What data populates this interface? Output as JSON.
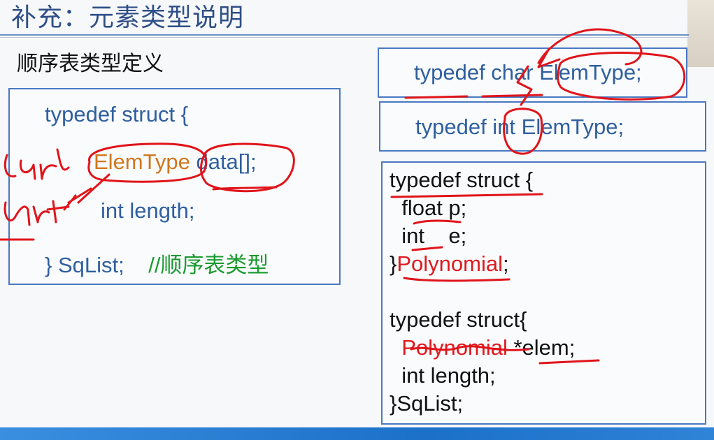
{
  "slide": {
    "title": "补充：元素类型说明",
    "subtitle": "顺序表类型定义"
  },
  "left_box": {
    "line1": "typedef struct {",
    "line2_type": "ElemType",
    "line2_rest": " data[];",
    "line3": "int length;",
    "line4_code": "} SqList;",
    "line4_comment": "//顺序表类型"
  },
  "right_top": {
    "box1": "typedef char ElemType;",
    "box2": "typedef int ElemType;"
  },
  "right_code": {
    "l1": "typedef struct {",
    "l2": "  float p;",
    "l3": "  int    e;",
    "l4_brace": "}",
    "l4_name": "Polynomial",
    "l4_end": ";",
    "l5": "typedef struct{",
    "l6_name": "Polynomial",
    "l6_rest": " *elem;",
    "l7": "  int length;",
    "l8": "}SqList;"
  },
  "handwriting": {
    "left_word1": "char",
    "left_word2": "int"
  }
}
